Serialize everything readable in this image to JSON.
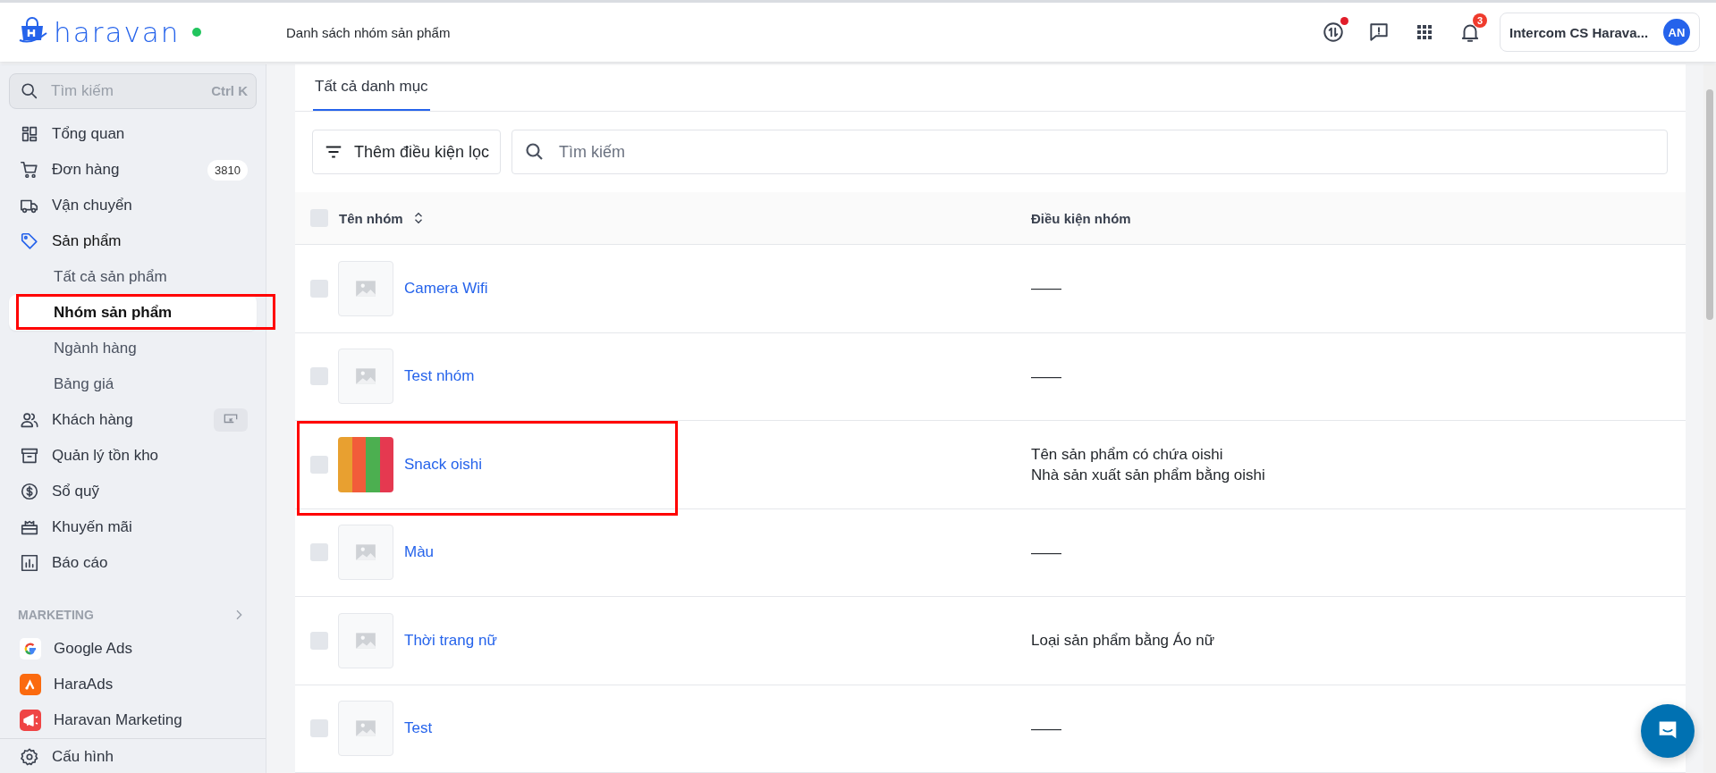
{
  "topbar": {
    "brand": "haravan",
    "online": true,
    "page_title": "Danh sách nhóm sản phẩm",
    "sync_alert": true,
    "notification_count": "3",
    "account_name": "Intercom CS Harava...",
    "avatar_initials": "AN"
  },
  "sidebar": {
    "search": {
      "placeholder": "Tìm kiếm",
      "shortcut": "Ctrl K"
    },
    "items": [
      {
        "label": "Tổng quan",
        "selected": false
      },
      {
        "label": "Đơn hàng",
        "selected": false,
        "badge": "3810"
      },
      {
        "label": "Vận chuyển",
        "selected": false
      },
      {
        "label": "Sản phẩm",
        "selected": true,
        "expanded": true,
        "children": [
          {
            "label": "Tất cả sản phẩm",
            "selected": false,
            "highlighted": false
          },
          {
            "label": "Nhóm sản phẩm",
            "selected": true,
            "highlighted": true
          },
          {
            "label": "Ngành hàng",
            "selected": false,
            "highlighted": false
          },
          {
            "label": "Bảng giá",
            "selected": false,
            "highlighted": false
          }
        ]
      },
      {
        "label": "Khách hàng",
        "selected": false,
        "action_icon": true
      },
      {
        "label": "Quản lý tồn kho",
        "selected": false
      },
      {
        "label": "Sổ quỹ",
        "selected": false
      },
      {
        "label": "Khuyến mãi",
        "selected": false
      },
      {
        "label": "Báo cáo",
        "selected": false
      }
    ],
    "marketing": {
      "title": "MARKETING",
      "apps": [
        {
          "label": "Google Ads"
        },
        {
          "label": "HaraAds"
        },
        {
          "label": "Haravan Marketing"
        }
      ]
    },
    "footer": {
      "label": "Cấu hình"
    }
  },
  "content": {
    "tabs": [
      {
        "label": "Tất cả danh mục",
        "selected": true
      }
    ],
    "filter_button": "Thêm điều kiện lọc",
    "search": {
      "placeholder": "Tìm kiếm"
    },
    "table": {
      "columns": [
        "Tên nhóm",
        "Điều kiện nhóm"
      ],
      "all_checked": false,
      "rows": [
        {
          "checked": false,
          "kind": "placeholder",
          "name": "Camera Wifi",
          "conditions": [
            "——"
          ],
          "highlighted": false
        },
        {
          "checked": false,
          "kind": "placeholder",
          "name": "Test nhóm",
          "conditions": [
            "——"
          ],
          "highlighted": false
        },
        {
          "checked": false,
          "kind": "photo",
          "name": "Snack oishi",
          "conditions": [
            "Tên sản phẩm có chứa oishi",
            "Nhà sản xuất sản phẩm bằng oishi"
          ],
          "highlighted": true
        },
        {
          "checked": false,
          "kind": "placeholder",
          "name": "Màu",
          "conditions": [
            "——"
          ],
          "highlighted": false
        },
        {
          "checked": false,
          "kind": "placeholder",
          "name": "Thời trang nữ",
          "conditions": [
            "Loại sản phẩm bằng Áo nữ"
          ],
          "highlighted": false
        },
        {
          "checked": false,
          "kind": "placeholder",
          "name": "Test",
          "conditions": [
            "——"
          ],
          "highlighted": false
        }
      ]
    }
  }
}
